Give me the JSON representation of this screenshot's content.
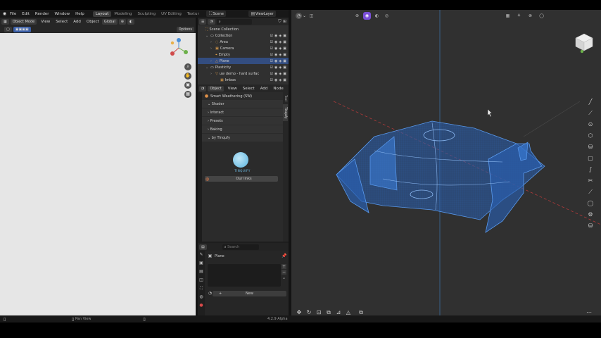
{
  "topbar": {
    "menus": [
      "File",
      "Edit",
      "Render",
      "Window",
      "Help"
    ],
    "workspaces": [
      "Layout",
      "Modeling",
      "Sculpting",
      "UV Editing",
      "Textur"
    ],
    "active_workspace": "Layout",
    "scene_label": "Scene",
    "view_layer_label": "ViewLayer"
  },
  "left_header": {
    "mode": "Object Mode",
    "menus": [
      "View",
      "Select",
      "Add",
      "Object"
    ],
    "transform": "Global",
    "options": "Options"
  },
  "outliner": {
    "search_placeholder": "",
    "items": [
      {
        "label": "Scene Collection",
        "indent": 0
      },
      {
        "label": "Collection",
        "indent": 1
      },
      {
        "label": "Area",
        "indent": 2
      },
      {
        "label": "Camera",
        "indent": 2
      },
      {
        "label": "Empty",
        "indent": 2
      },
      {
        "label": "Plane",
        "indent": 2,
        "selected": true
      },
      {
        "label": "Plasticity",
        "indent": 1
      },
      {
        "label": "uw demo - hard surfac",
        "indent": 2
      },
      {
        "label": "Imbox",
        "indent": 3
      }
    ]
  },
  "node_header": {
    "object_label": "Object",
    "menus": [
      "View",
      "Select",
      "Add",
      "Node"
    ]
  },
  "addon_panel": {
    "title": "Smart Weathering (SW)",
    "sections": [
      "Shader",
      "Interact",
      "Presets",
      "Baking",
      "by Tinqufy"
    ],
    "logo_text": "TINQUIFY",
    "link_label": "Our links",
    "side_tabs": [
      "Tool",
      "Tinqufy"
    ]
  },
  "properties": {
    "search_placeholder": "Search",
    "object_name": "Plane",
    "new_label": "New"
  },
  "status_bar": {
    "pan_label": "Pan View",
    "version": "4.2.9 Alpha"
  },
  "colors": {
    "mesh": "#3a7bd5",
    "mesh_fill": "#2a5fb0",
    "selection": "#334d80",
    "accent": "#7a4fd8",
    "x_axis": "#b03a3a",
    "y_axis": "#3a8fb0"
  }
}
